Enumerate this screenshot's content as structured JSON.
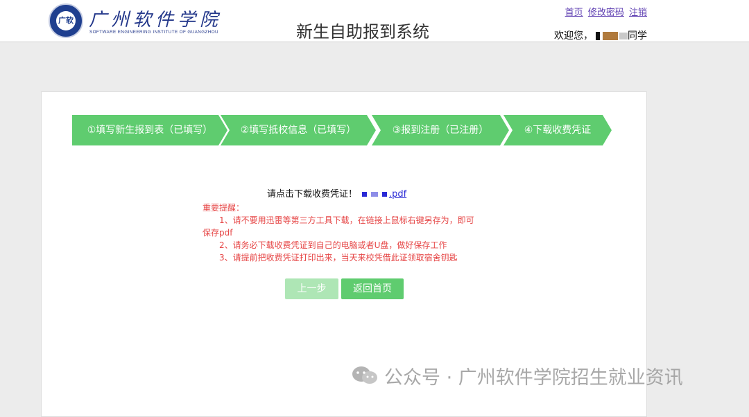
{
  "header": {
    "logo_seal_text": "广软",
    "logo_cn": "广州软件学院",
    "logo_en": "SOFTWARE ENGINEERING INSTITUTE OF GUANGZHOU",
    "system_title": "新生自助报到系统",
    "links": {
      "home": "首页",
      "change_password": "修改密码",
      "logout": "注销"
    },
    "welcome_prefix": "欢迎您，",
    "welcome_suffix": "同学"
  },
  "steps": [
    {
      "label": "①填写新生报到表（已填写）",
      "status": "done"
    },
    {
      "label": "②填写抵校信息（已填写）",
      "status": "done"
    },
    {
      "label": "③报到注册（已注册）",
      "status": "done"
    },
    {
      "label": "④下载收费凭证",
      "status": "current"
    }
  ],
  "download": {
    "prompt": "请点击下载收费凭证！",
    "file_suffix": ".pdf"
  },
  "notice": {
    "title": "重要提醒：",
    "items": [
      "1、请不要用迅雷等第三方工具下载，在链接上鼠标右键另存为，即可保存pdf",
      "2、请务必下载收费凭证到自己的电脑或者U盘，做好保存工作",
      "3、请提前把收费凭证打印出来，当天来校凭借此证领取宿舍钥匙"
    ]
  },
  "buttons": {
    "prev": "上一步",
    "home": "返回首页"
  },
  "watermark": "公众号 · 广州软件学院招生就业资讯",
  "colors": {
    "step_green": "#5fcc6f",
    "notice_red": "#e64545",
    "link": "#2a2ad6"
  }
}
